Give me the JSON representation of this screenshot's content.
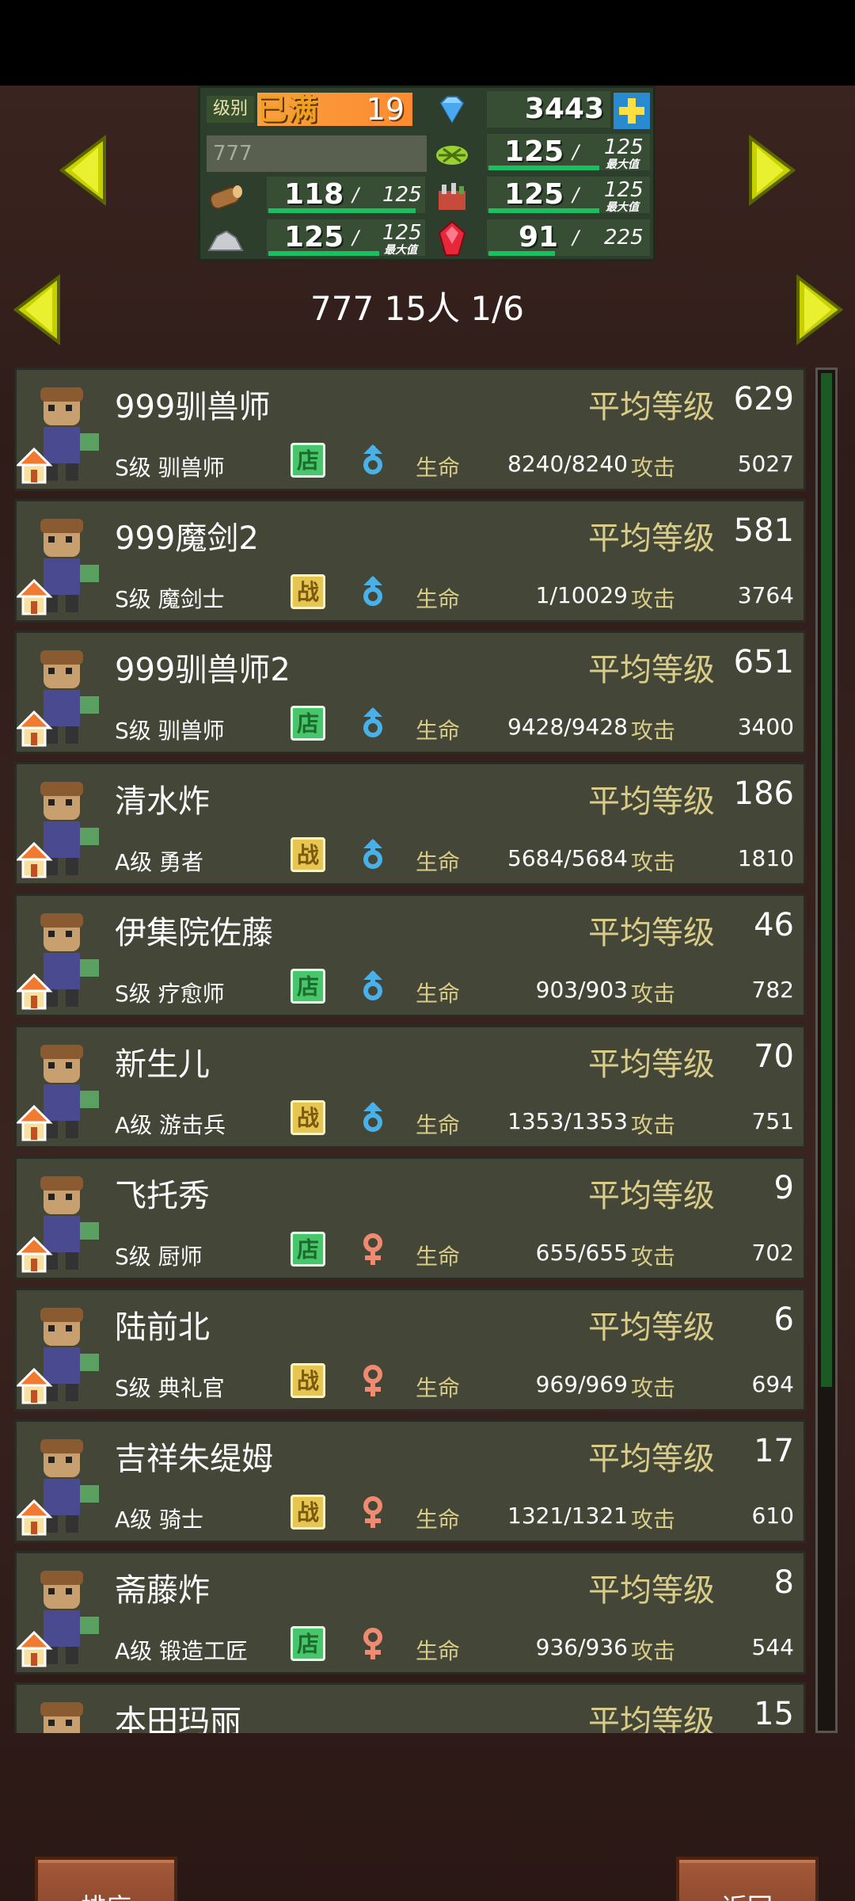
{
  "top": {
    "level_label": "级别",
    "level_max": "已满",
    "level_value": "19",
    "gems": "3443",
    "name_field_value": "777",
    "resources": {
      "grass": {
        "value": "125",
        "max": "125",
        "max_tag": "最大值"
      },
      "wood": {
        "value": "118",
        "max": "125"
      },
      "food": {
        "value": "125",
        "max": "125",
        "max_tag": "最大值"
      },
      "stone": {
        "value": "125",
        "max": "125",
        "max_tag": "最大值"
      },
      "ruby": {
        "value": "91",
        "max": "225"
      }
    }
  },
  "page": {
    "title": "777  15人 1/6"
  },
  "labels": {
    "avg_level": "平均等级",
    "hp": "生命",
    "atk": "攻击"
  },
  "characters": [
    {
      "name": "999驯兽师",
      "avg_level": "629",
      "rank_job": "S级 驯兽师",
      "type": "店",
      "gender": "male",
      "hp": "8240/8240",
      "atk": "5027"
    },
    {
      "name": "999魔剑2",
      "avg_level": "581",
      "rank_job": "S级 魔剑士",
      "type": "战",
      "gender": "male",
      "hp": "1/10029",
      "atk": "3764"
    },
    {
      "name": "999驯兽师2",
      "avg_level": "651",
      "rank_job": "S级 驯兽师",
      "type": "店",
      "gender": "male",
      "hp": "9428/9428",
      "atk": "3400"
    },
    {
      "name": "清水炸",
      "avg_level": "186",
      "rank_job": "A级 勇者",
      "type": "战",
      "gender": "male",
      "hp": "5684/5684",
      "atk": "1810"
    },
    {
      "name": "伊集院佐藤",
      "avg_level": "46",
      "rank_job": "S级 疗愈师",
      "type": "店",
      "gender": "male",
      "hp": "903/903",
      "atk": "782"
    },
    {
      "name": "新生儿",
      "avg_level": "70",
      "rank_job": "A级 游击兵",
      "type": "战",
      "gender": "male",
      "hp": "1353/1353",
      "atk": "751"
    },
    {
      "name": "飞托秀",
      "avg_level": "9",
      "rank_job": "S级 厨师",
      "type": "店",
      "gender": "female",
      "hp": "655/655",
      "atk": "702"
    },
    {
      "name": "陆前北",
      "avg_level": "6",
      "rank_job": "S级 典礼官",
      "type": "战",
      "gender": "female",
      "hp": "969/969",
      "atk": "694"
    },
    {
      "name": "吉祥朱缇姆",
      "avg_level": "17",
      "rank_job": "A级 骑士",
      "type": "战",
      "gender": "female",
      "hp": "1321/1321",
      "atk": "610"
    },
    {
      "name": "斋藤炸",
      "avg_level": "8",
      "rank_job": "A级 锻造工匠",
      "type": "店",
      "gender": "female",
      "hp": "936/936",
      "atk": "544"
    },
    {
      "name": "本田玛丽",
      "avg_level": "15",
      "rank_job": "",
      "type": "",
      "gender": "",
      "hp": "",
      "atk": ""
    }
  ],
  "buttons": {
    "sort": "排序",
    "back": "返回"
  },
  "colors": {
    "shop_badge": "#48c66c",
    "war_badge": "#e6c650",
    "male": "#4ab0e8",
    "female": "#f08a70",
    "accent_text": "#d8cc88"
  }
}
